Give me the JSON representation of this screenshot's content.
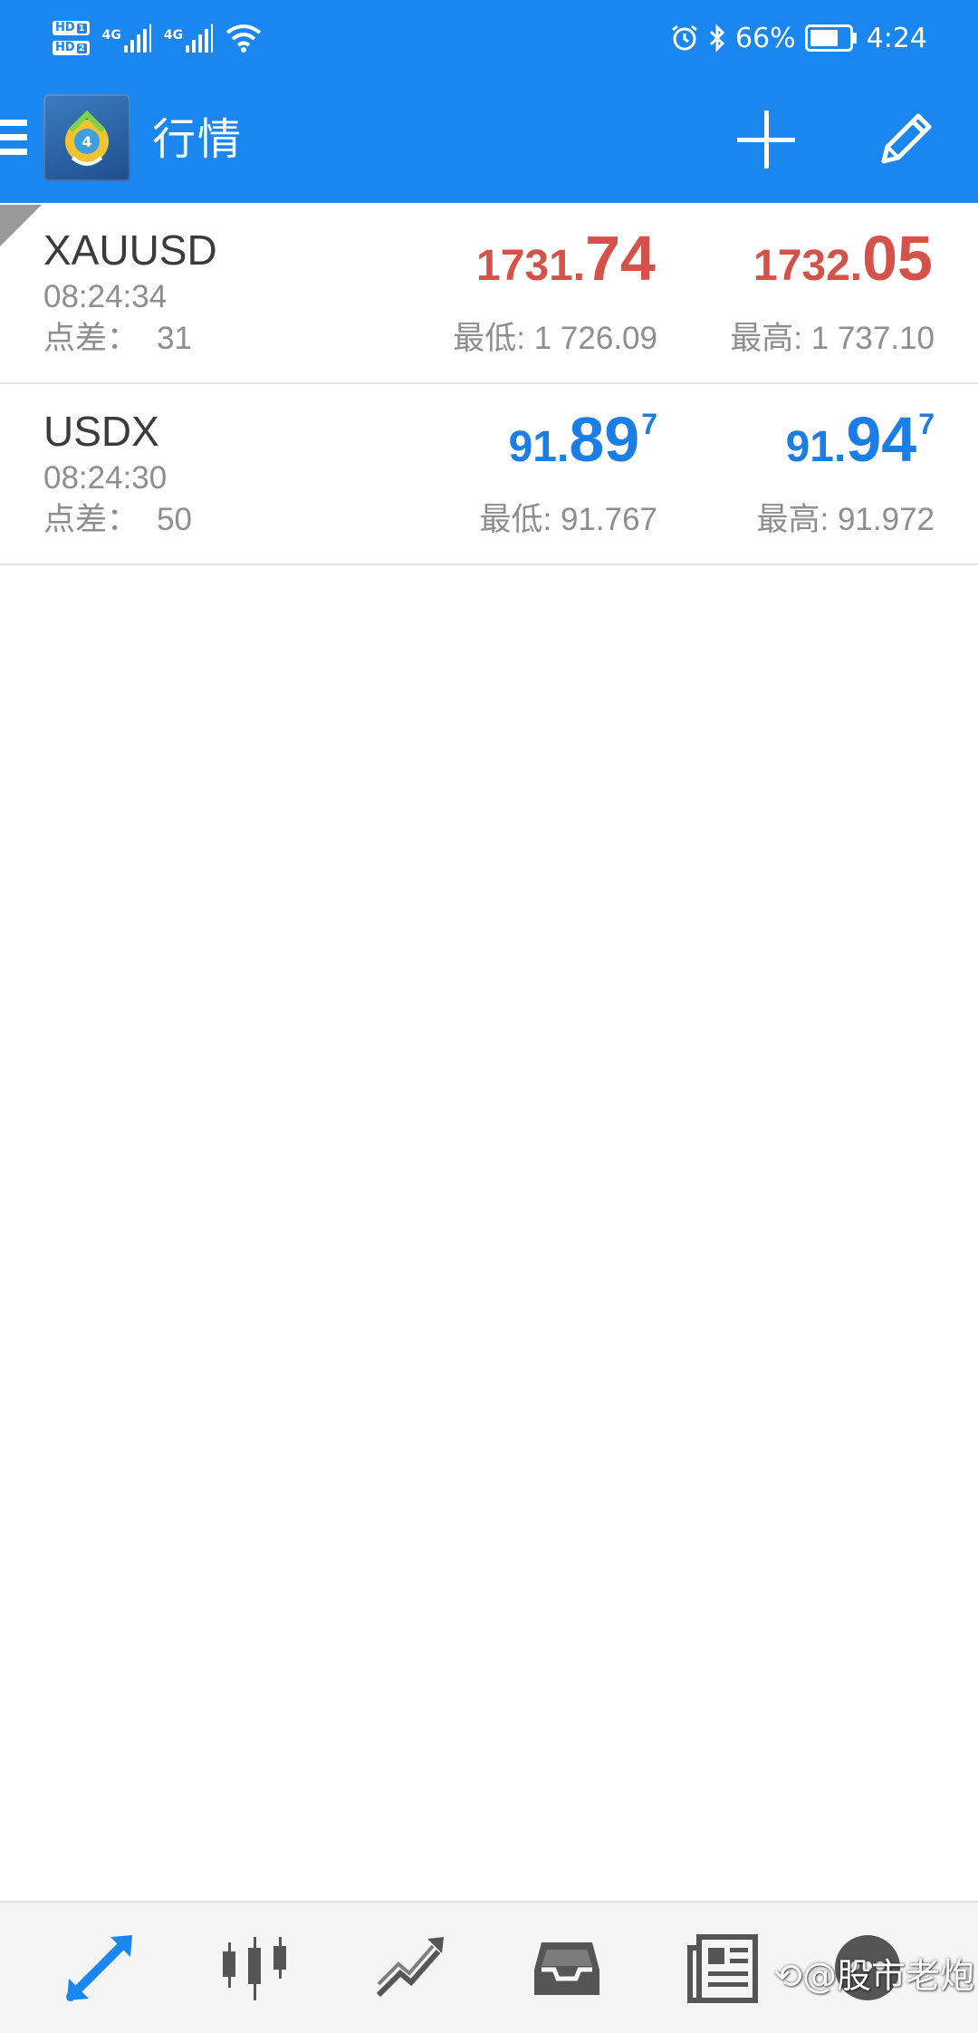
{
  "status_bar": {
    "hd1": "HD",
    "hd1_sub": "1",
    "hd2": "HD",
    "hd2_sub": "2",
    "network1": "4G",
    "network2": "4G",
    "battery": "66%",
    "time": "4:24"
  },
  "header": {
    "title": "行情"
  },
  "quotes": [
    {
      "symbol": "XAUUSD",
      "time": "08:24:34",
      "spread_label": "点差：",
      "spread": "31",
      "bid_small": "1731.",
      "bid_big": "74",
      "bid_sup": "",
      "ask_small": "1732.",
      "ask_big": "05",
      "ask_sup": "",
      "low": "最低: 1 726.09",
      "high": "最高: 1 737.10",
      "color": "#d4524a"
    },
    {
      "symbol": "USDX",
      "time": "08:24:30",
      "spread_label": "点差：",
      "spread": "50",
      "bid_small": "91.",
      "bid_big": "89",
      "bid_sup": "7",
      "ask_small": "91.",
      "ask_big": "94",
      "ask_sup": "7",
      "low": "最低: 91.767",
      "high": "最高: 91.972",
      "color": "#1b7ee6"
    }
  ],
  "bottom_nav": {
    "items": [
      {
        "icon": "quotes-arrows-icon",
        "active": true
      },
      {
        "icon": "candlestick-chart-icon",
        "active": false
      },
      {
        "icon": "trend-chart-icon",
        "active": false
      },
      {
        "icon": "inbox-tray-icon",
        "active": false
      },
      {
        "icon": "news-icon",
        "active": false
      },
      {
        "icon": "chat-icon",
        "active": false
      }
    ],
    "watermark": "⟲@股市老炮"
  },
  "colors": {
    "primary": "#1a86f0",
    "down_red": "#d4524a",
    "up_blue": "#1b7ee6",
    "muted_text": "#8e8e8e",
    "active_nav": "#1a86f0",
    "inactive_nav": "#555555"
  }
}
